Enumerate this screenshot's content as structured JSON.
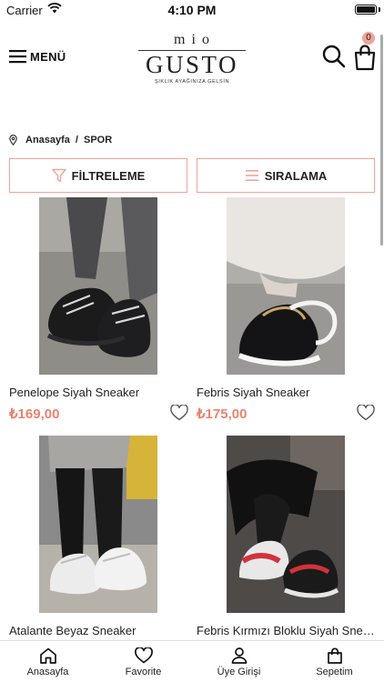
{
  "status_bar": {
    "carrier": "Carrier",
    "time": "4:10 PM"
  },
  "header": {
    "menu_label": "MENÜ",
    "logo": {
      "top": "mio",
      "main": "GUSTO",
      "tagline": "ŞIKLIK AYAĞINIZA GELSİN"
    },
    "cart_count": "0"
  },
  "breadcrumb": {
    "home": "Anasayfa",
    "separator": "/",
    "current": "SPOR"
  },
  "actions": {
    "filter_label": "FİLTRELEME",
    "sort_label": "SIRALAMA"
  },
  "products": [
    {
      "name": "Penelope Siyah Sneaker",
      "price": "₺169,00",
      "image": "black-chunky-sneaker-photo"
    },
    {
      "name": "Febris Siyah Sneaker",
      "price": "₺175,00",
      "image": "black-gold-sneaker-photo"
    },
    {
      "name": "Atalante Beyaz Sneaker",
      "price": "",
      "image": "white-chunky-sneaker-photo"
    },
    {
      "name": "Febris Kırmızı Bloklu Siyah Sneaker",
      "price": "",
      "image": "red-black-sneaker-photo"
    }
  ],
  "tab_bar": [
    {
      "label": "Anasayfa",
      "icon": "home-icon"
    },
    {
      "label": "Favorite",
      "icon": "heart-icon"
    },
    {
      "label": "Üye Girişi",
      "icon": "user-icon"
    },
    {
      "label": "Sepetim",
      "icon": "bag-icon"
    }
  ],
  "colors": {
    "accent": "#e9836f",
    "border_accent": "#f0a49a"
  }
}
